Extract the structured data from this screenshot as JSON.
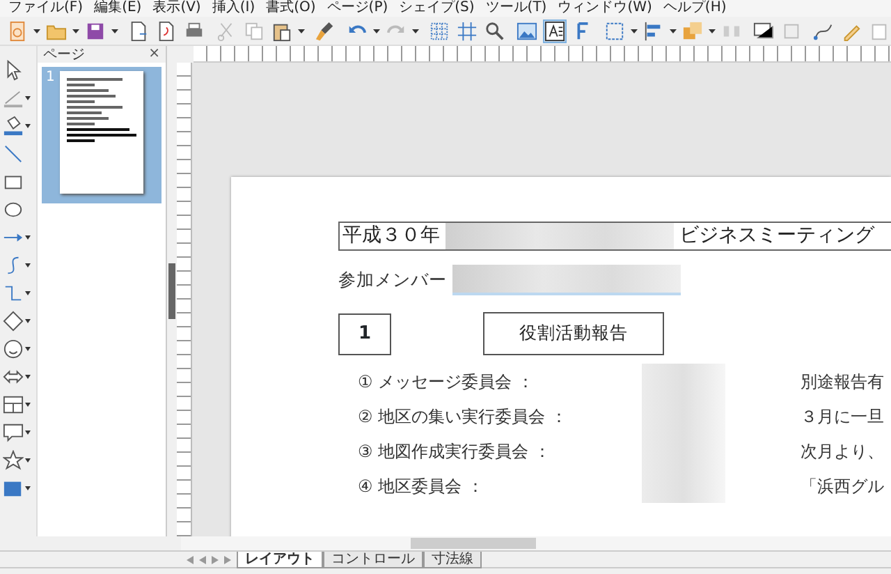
{
  "menu": [
    "ファイル(F)",
    "編集(E)",
    "表示(V)",
    "挿入(I)",
    "書式(O)",
    "ページ(P)",
    "シェイプ(S)",
    "ツール(T)",
    "ウィンドウ(W)",
    "ヘルプ(H)"
  ],
  "pages_panel": {
    "title": "ページ",
    "close": "×",
    "pages": [
      {
        "number": "1",
        "selected": true
      }
    ]
  },
  "document": {
    "title_start": "平成３０年",
    "title_end": "ビジネスミーティング",
    "members_label": "参加メンバー",
    "section_number": "1",
    "section_title": "役割活動報告",
    "items": [
      {
        "label": "① メッセージ委員会 ：",
        "note": "別途報告有"
      },
      {
        "label": "② 地区の集い実行委員会 ：",
        "note": "３月に一旦"
      },
      {
        "label": "③ 地図作成実行委員会 ：",
        "note": "次月より、"
      },
      {
        "label": "④ 地区委員会 ：",
        "note": "「浜西グル"
      }
    ]
  },
  "layer_tabs": [
    {
      "label": "レイアウト",
      "selected": true
    },
    {
      "label": "コントロール",
      "selected": false
    },
    {
      "label": "寸法線",
      "selected": false
    }
  ]
}
